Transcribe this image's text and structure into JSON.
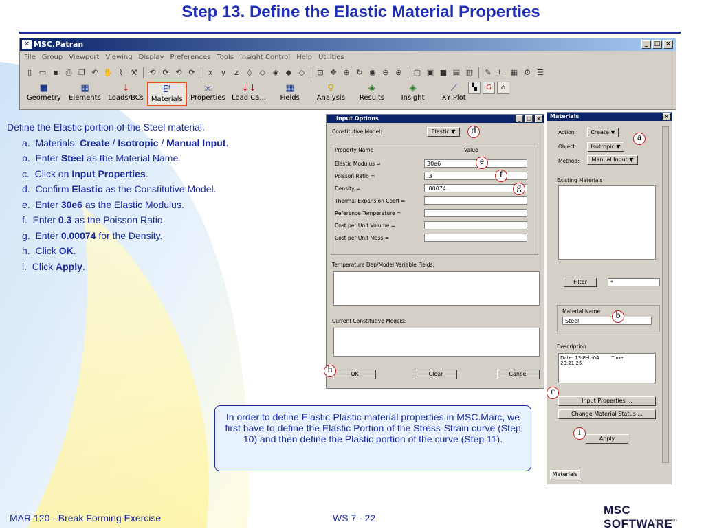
{
  "slide": {
    "title": "Step 13. Define the Elastic Material Properties",
    "footer_left": "MAR 120 - Break Forming Exercise",
    "footer_center": "WS 7 - 22",
    "logo_text": "MSC SOFTWARE",
    "logo_tagline": "SIMULATING REALITY"
  },
  "patran": {
    "window_title": "MSC.Patran",
    "menus": [
      "File",
      "Group",
      "Viewport",
      "Viewing",
      "Display",
      "Preferences",
      "Tools",
      "Insight Control",
      "Help",
      "Utilities"
    ],
    "apps": [
      {
        "label": "Geometry",
        "icon": "cube-icon"
      },
      {
        "label": "Elements",
        "icon": "mesh-icon"
      },
      {
        "label": "Loads/BCs",
        "icon": "arrow-load-icon"
      },
      {
        "label": "Materials",
        "icon": "materials-icon",
        "selected": true
      },
      {
        "label": "Properties",
        "icon": "properties-icon"
      },
      {
        "label": "Load Ca...",
        "icon": "load-case-icon"
      },
      {
        "label": "Fields",
        "icon": "grid-icon"
      },
      {
        "label": "Analysis",
        "icon": "bulb-icon"
      },
      {
        "label": "Results",
        "icon": "results-icon"
      },
      {
        "label": "Insight",
        "icon": "insight-icon"
      },
      {
        "label": "XY Plot",
        "icon": "chart-icon"
      }
    ]
  },
  "steps": {
    "intro": "Define the Elastic portion of the Steel material.",
    "items": [
      {
        "n": "a.",
        "pre": "Materials: ",
        "b1": "Create",
        "m1": " / ",
        "b2": "Isotropic",
        "m2": " / ",
        "b3": "Manual Input",
        "post": "."
      },
      {
        "n": "b.",
        "pre": "Enter ",
        "b1": "Steel",
        "post": " as the Material Name."
      },
      {
        "n": "c.",
        "pre": "Click on ",
        "b1": "Input Properties",
        "post": "."
      },
      {
        "n": "d.",
        "pre": "Confirm  ",
        "b1": "Elastic",
        "post": " as the Constitutive Model."
      },
      {
        "n": "e.",
        "pre": "Enter ",
        "b1": "30e6",
        "post": " as the Elastic Modulus."
      },
      {
        "n": "f.",
        "pre": "Enter ",
        "b1": "0.3",
        "post": " as the Poisson Ratio."
      },
      {
        "n": "g.",
        "pre": "Enter ",
        "b1": "0.00074",
        "post": " for the Density."
      },
      {
        "n": "h.",
        "pre": "Click ",
        "b1": "OK",
        "post": "."
      },
      {
        "n": "i.",
        "pre": "Click ",
        "b1": "Apply",
        "post": "."
      }
    ]
  },
  "input_options": {
    "title": "Input Options",
    "constitutive_label": "Constitutive Model:",
    "constitutive_value": "Elastic",
    "prop_name_header": "Property Name",
    "value_header": "Value",
    "properties": [
      {
        "label": "Elastic Modulus =",
        "value": "30e6"
      },
      {
        "label": "Poisson Ratio =",
        "value": ".3"
      },
      {
        "label": "Density =",
        "value": ".00074"
      },
      {
        "label": "Thermal Expansion Coeff =",
        "value": ""
      },
      {
        "label": "Reference Temperature =",
        "value": ""
      },
      {
        "label": "Cost per Unit Volume =",
        "value": ""
      },
      {
        "label": "Cost per Unit Mass =",
        "value": ""
      }
    ],
    "temp_dep_label": "Temperature Dep/Model Variable Fields:",
    "current_models_label": "Current Constitutive Models:",
    "ok": "OK",
    "clear": "Clear",
    "cancel": "Cancel"
  },
  "materials": {
    "title": "Materials",
    "action_label": "Action:",
    "action_value": "Create",
    "object_label": "Object:",
    "object_value": "Isotropic",
    "method_label": "Method:",
    "method_value": "Manual Input",
    "existing_label": "Existing Materials",
    "filter_button": "Filter",
    "filter_value": "*",
    "material_name_label": "Material Name",
    "material_name_value": "Steel",
    "description_label": "Description",
    "description_line1": "Date: 13-Feb-04        Time:",
    "description_line2": "20:21:25",
    "input_properties_button": "Input Properties ...",
    "change_status_button": "Change Material Status ...",
    "apply_button": "Apply",
    "tab_label": "Materials"
  },
  "callouts": [
    "a",
    "b",
    "c",
    "d",
    "e",
    "f",
    "g",
    "h",
    "i"
  ],
  "info": "In order to define Elastic-Plastic material properties in MSC.Marc, we first have to define the Elastic Portion of the Stress-Strain curve (Step 10) and then define the Plastic portion of the curve (Step 11).",
  "colors": {
    "title_blue": "#1f2fb8",
    "text_blue": "#1a2a9c",
    "highlight": "#e0531d",
    "callout_red": "#c02020"
  }
}
